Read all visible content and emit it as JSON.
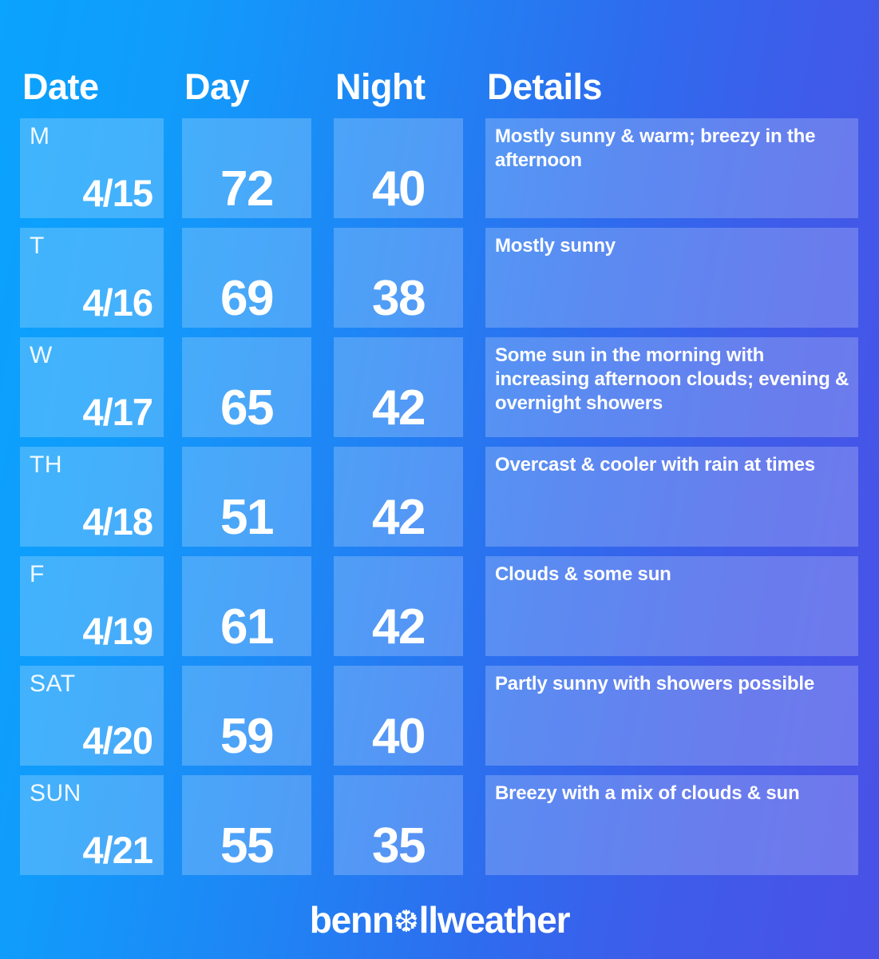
{
  "theme": {
    "gradient_start": "#0DA1FC",
    "gradient_end": "#4A51E6",
    "cell_overlay": "rgba(255,255,255,0.215)",
    "text_color": "#FFFFFF"
  },
  "header": {
    "date_label": "Date",
    "day_label": "Day",
    "night_label": "Night",
    "details_label": "Details"
  },
  "forecast": [
    {
      "dow": "M",
      "date": "4/15",
      "day": "72",
      "night": "40",
      "details": "Mostly sunny & warm; breezy in the afternoon"
    },
    {
      "dow": "T",
      "date": "4/16",
      "day": "69",
      "night": "38",
      "details": "Mostly sunny"
    },
    {
      "dow": "W",
      "date": "4/17",
      "day": "65",
      "night": "42",
      "details": "Some sun in the morning with increasing afternoon clouds; evening & overnight showers"
    },
    {
      "dow": "TH",
      "date": "4/18",
      "day": "51",
      "night": "42",
      "details": "Overcast & cooler with rain at times"
    },
    {
      "dow": "F",
      "date": "4/19",
      "day": "61",
      "night": "42",
      "details": "Clouds & some sun"
    },
    {
      "dow": "SAT",
      "date": "4/20",
      "day": "59",
      "night": "40",
      "details": "Partly sunny with showers possible"
    },
    {
      "dow": "SUN",
      "date": "4/21",
      "day": "55",
      "night": "35",
      "details": "Breezy with a mix of clouds & sun"
    }
  ],
  "footer": {
    "brand_prefix": "benn",
    "brand_icon": "snowflake-icon",
    "brand_icon_glyph": "❆",
    "brand_suffix": "llweather"
  }
}
